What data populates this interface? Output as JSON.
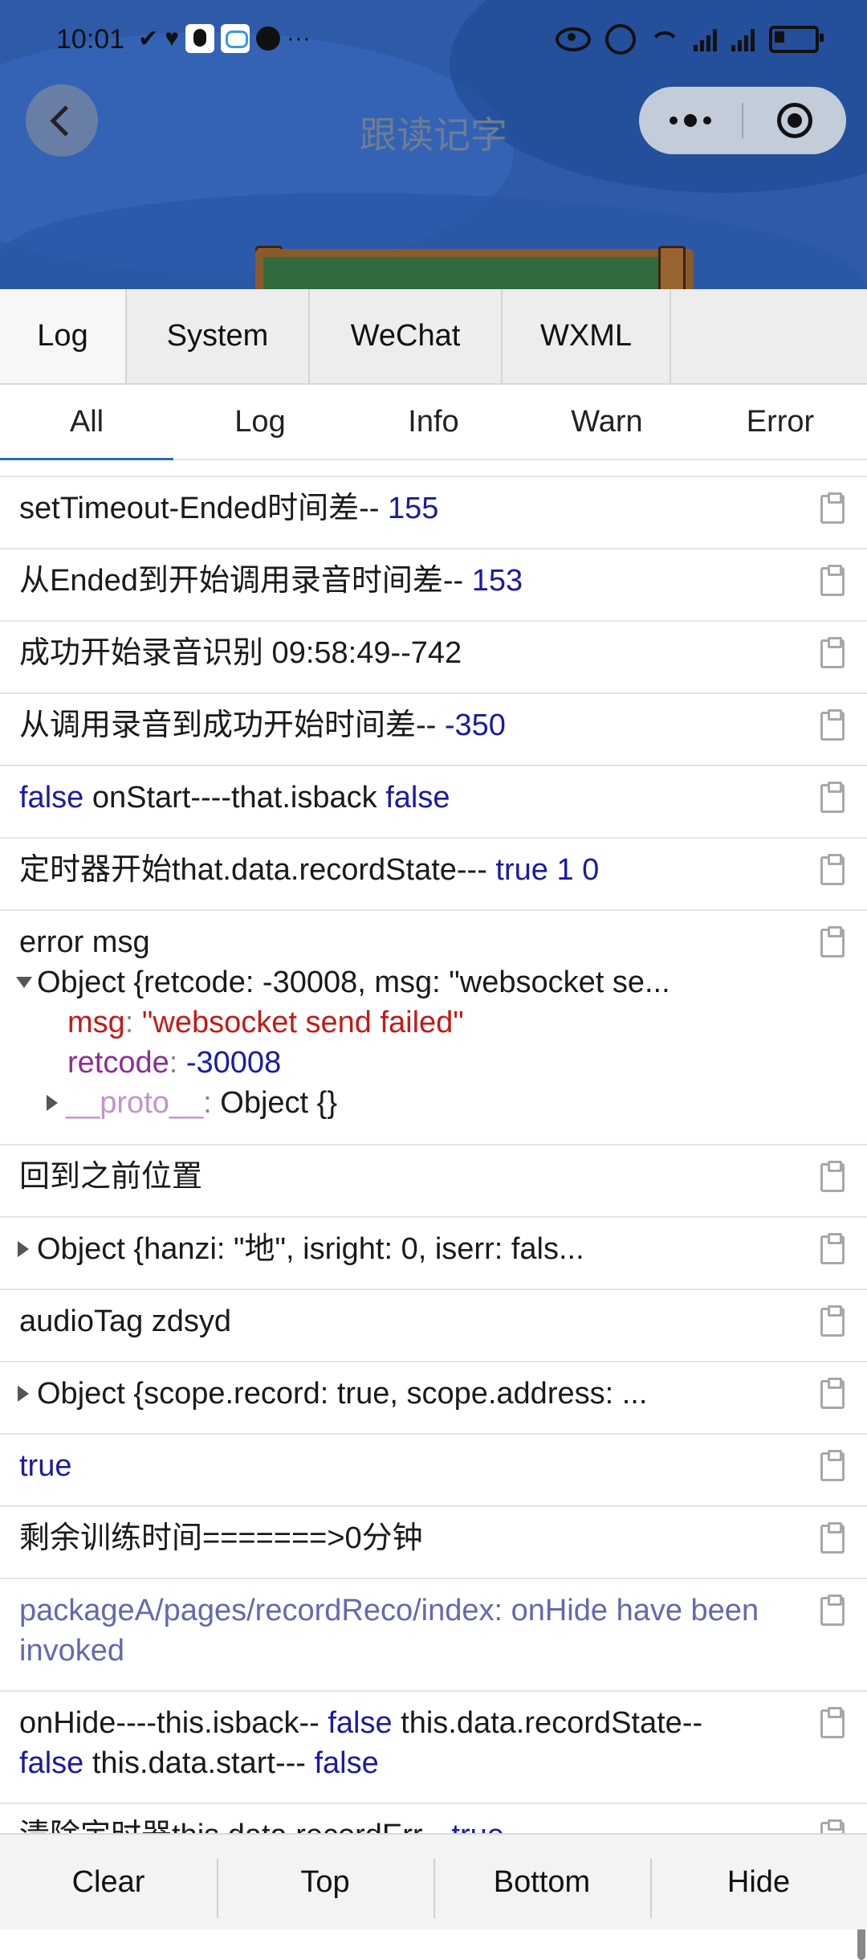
{
  "status_bar": {
    "time": "10:01",
    "ellipsis": "···"
  },
  "nav": {
    "title": "跟读记字"
  },
  "console": {
    "tabs": [
      "Log",
      "System",
      "WeChat",
      "WXML"
    ],
    "subtabs": [
      "All",
      "Log",
      "Info",
      "Warn",
      "Error"
    ],
    "logs": [
      {
        "text": "setTimeout-Ended时间差-- ",
        "value": "155"
      },
      {
        "text": "从Ended到开始调用录音时间差-- ",
        "value": "153"
      },
      {
        "text": "成功开始录音识别 09:58:49--742"
      },
      {
        "text": "从调用录音到成功开始时间差-- ",
        "value": "-350"
      },
      {
        "pre": "false",
        "text": " onStart----that.isback ",
        "value": "false"
      },
      {
        "text": "定时器开始that.data.recordState--- ",
        "value": "true 1 0"
      },
      {
        "text": "error msg",
        "summary": "Object {retcode: -30008, msg: \"websocket se...",
        "msg_key": "msg",
        "msg_val": "\"websocket send failed\"",
        "code_key": "retcode",
        "code_val": "-30008",
        "proto_key": "__proto__",
        "proto_val": "Object {}"
      },
      {
        "text": "回到之前位置"
      },
      {
        "text": "Object {hanzi: \"地\", isright: 0, iserr: fals..."
      },
      {
        "text": "audioTag zdsyd"
      },
      {
        "text": "Object {scope.record: true, scope.address: ..."
      },
      {
        "text": "true"
      },
      {
        "text": "剩余训练时间=======>0分钟"
      },
      {
        "text": "packageA/pages/recordReco/index: onHide have been invoked"
      },
      {
        "text_a": "onHide----this.isback-- ",
        "bool_a": "false",
        "text_b": " this.data.recordState--",
        "bool_b": "false",
        "text_c": " this.data.start--- ",
        "bool_c": "false"
      },
      {
        "text": "清除定时器this.data.recordErr-- ",
        "value": "true"
      }
    ]
  },
  "toolbar": [
    "Clear",
    "Top",
    "Bottom",
    "Hide"
  ]
}
